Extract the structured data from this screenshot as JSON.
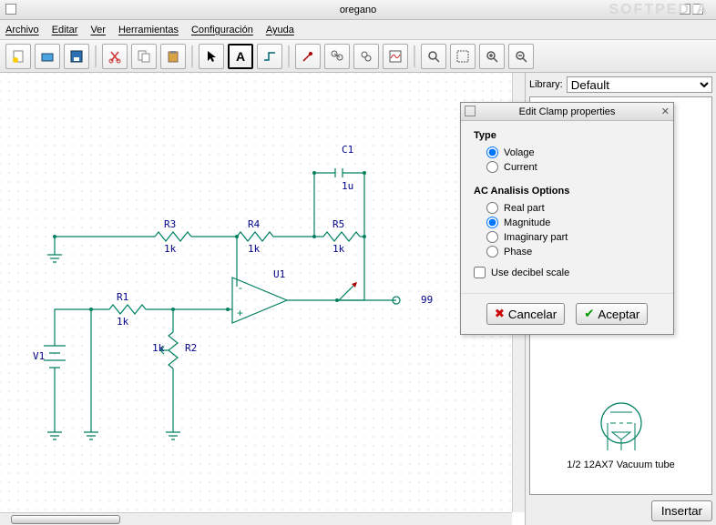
{
  "window": {
    "title": "oregano"
  },
  "menu": {
    "items": [
      "Archivo",
      "Editar",
      "Ver",
      "Herramientas",
      "Configuración",
      "Ayuda"
    ]
  },
  "toolbar": {
    "buttons": [
      "new",
      "open",
      "save",
      "cut",
      "copy",
      "paste",
      "select",
      "text",
      "wire",
      "probe",
      "parts",
      "run",
      "plot",
      "zoom-area",
      "zoom-fit",
      "zoom-in",
      "zoom-out"
    ]
  },
  "library": {
    "label": "Library:",
    "selected": "Default"
  },
  "preview": {
    "part_label": "1/2 12AX7 Vacuum tube"
  },
  "buttons": {
    "insert": "Insertar"
  },
  "dialog": {
    "title": "Edit Clamp properties",
    "type_heading": "Type",
    "type_options": {
      "voltage": "Volage",
      "current": "Current"
    },
    "type_selected": "voltage",
    "ac_heading": "AC Analisis Options",
    "ac_options": {
      "real": "Real part",
      "magnitude": "Magnitude",
      "imag": "Imaginary part",
      "phase": "Phase"
    },
    "ac_selected": "magnitude",
    "decibel": "Use decibel scale",
    "cancel": "Cancelar",
    "accept": "Aceptar"
  },
  "circuit": {
    "labels": {
      "C1": "C1",
      "C1v": "1u",
      "R3": "R3",
      "R3v": "1k",
      "R4": "R4",
      "R4v": "1k",
      "R5": "R5",
      "R5v": "1k",
      "U1": "U1",
      "R1": "R1",
      "R1v": "1k",
      "R2": "R2",
      "R2v": "1k",
      "V1": "V1",
      "net99": "99"
    }
  },
  "watermark": "SOFTPEDIA"
}
